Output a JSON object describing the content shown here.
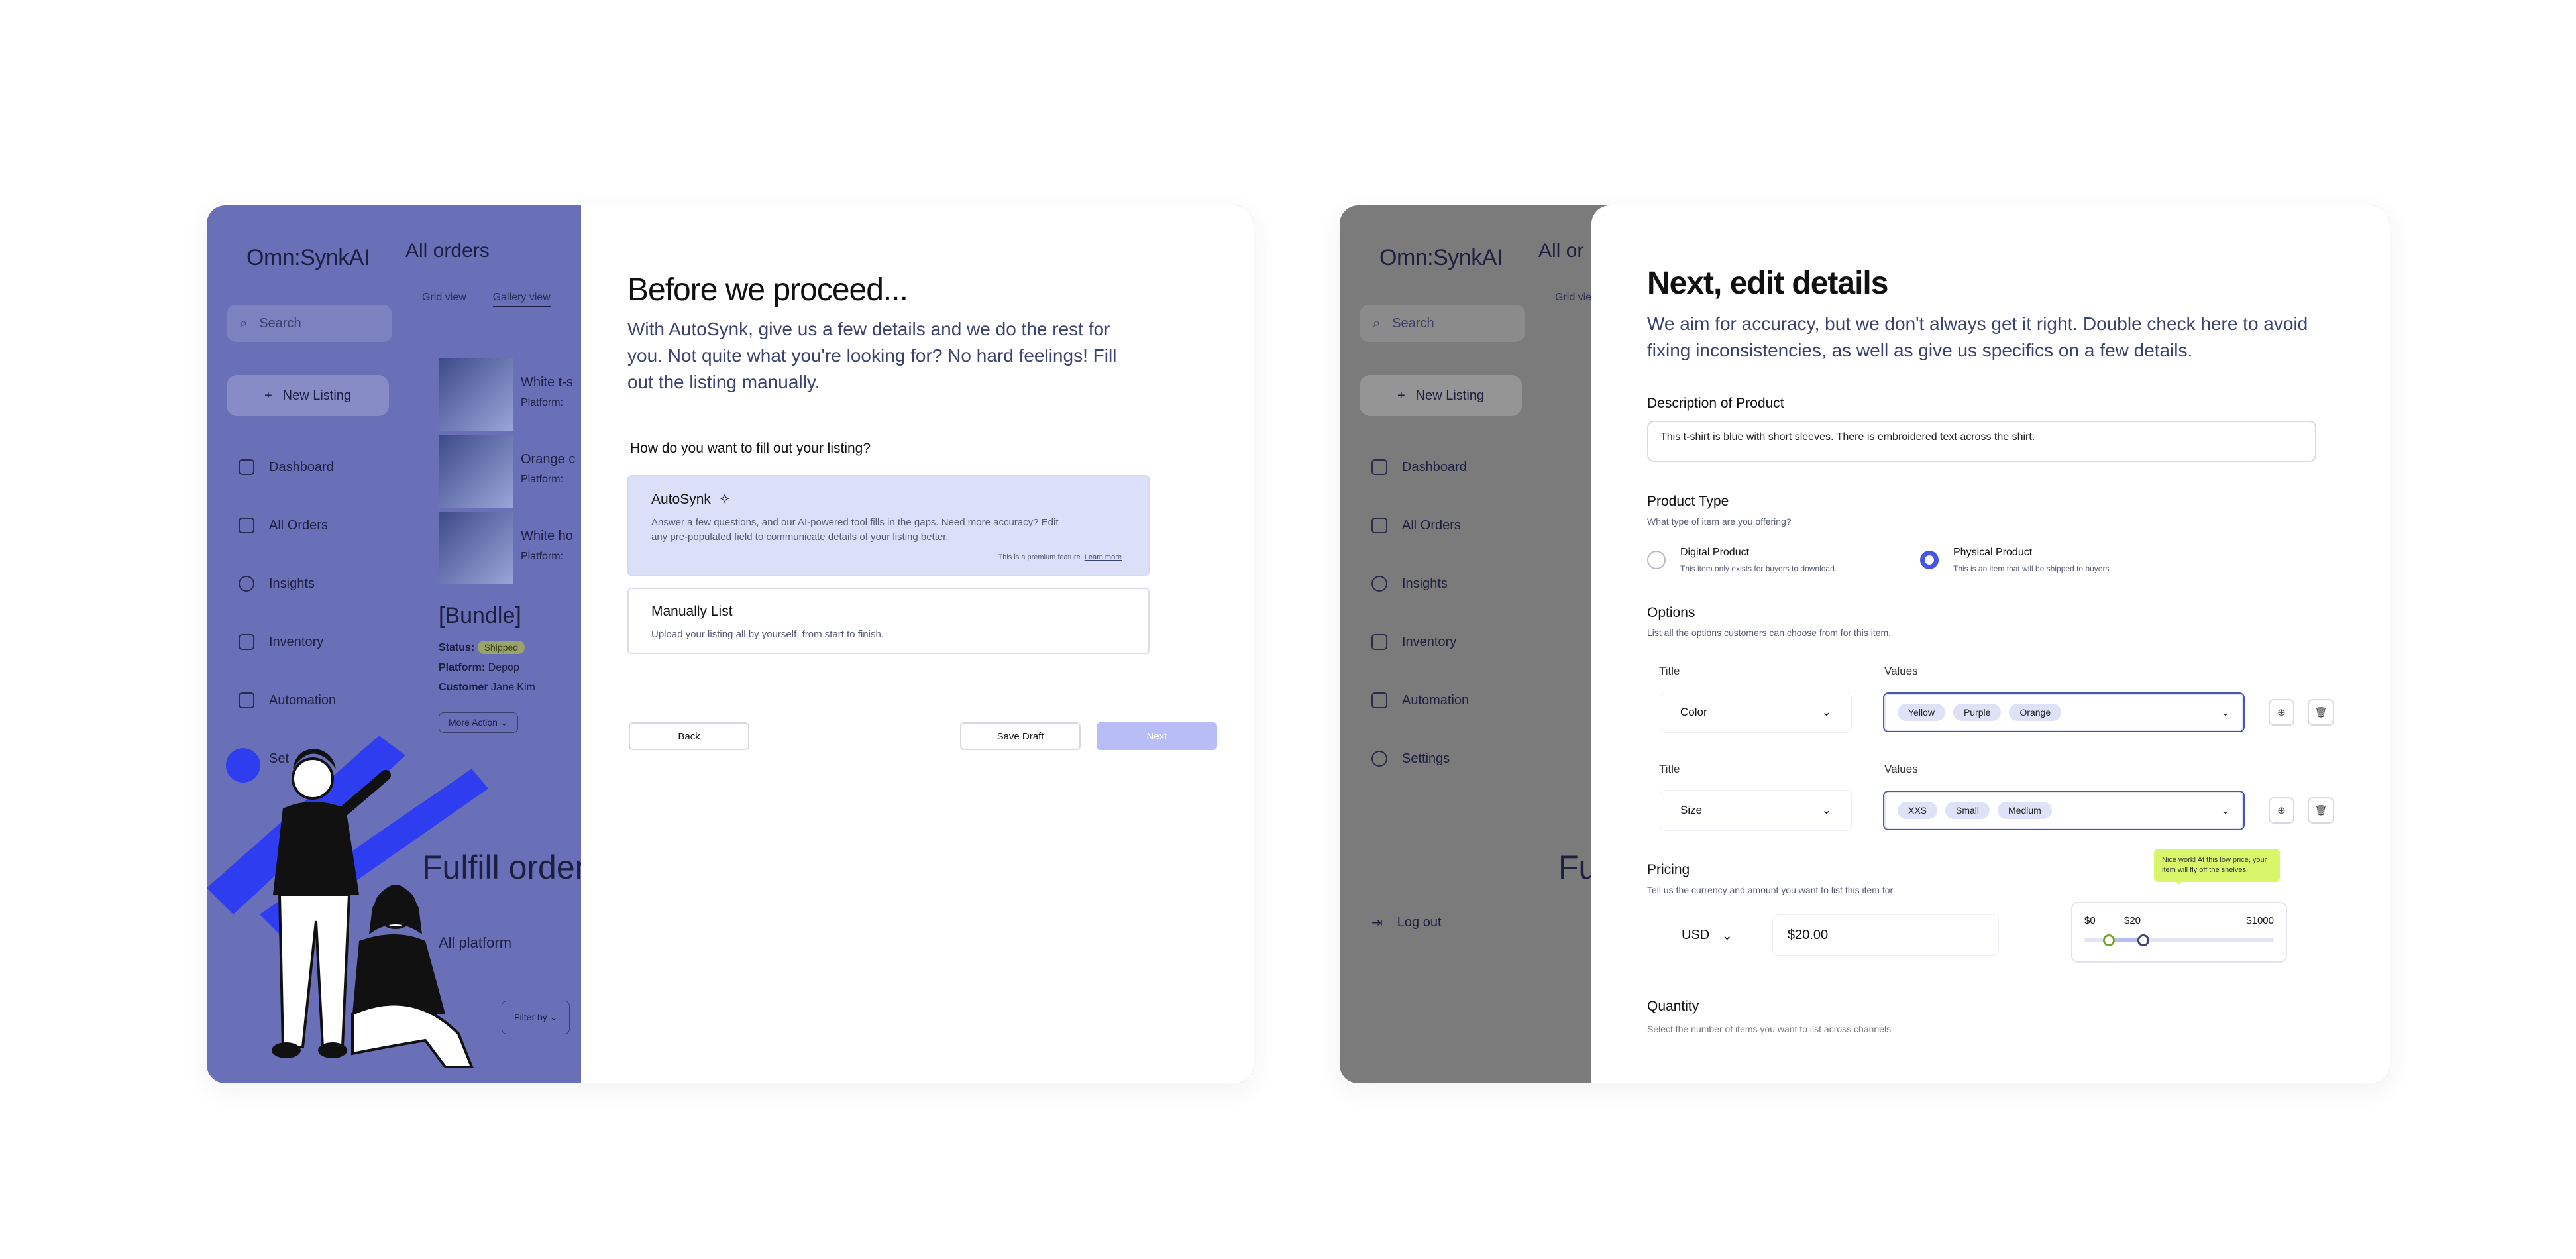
{
  "app": {
    "logo": "Omn:SynkAI",
    "page_title": "All orders",
    "view_tabs": [
      "Grid view",
      "Gallery view"
    ],
    "search_placeholder": "Search",
    "new_listing": "New Listing",
    "nav": [
      "Dashboard",
      "All Orders",
      "Insights",
      "Inventory",
      "Automation",
      "Settings"
    ],
    "nav_icons": [
      "house-icon",
      "calendar-icon",
      "pie-chart-icon",
      "bar-chart-icon",
      "monitor-icon",
      "gear-icon"
    ],
    "nav_left_visible": [
      "Dashboard",
      "All Orders",
      "Insights",
      "Inventory",
      "Automation",
      "Set"
    ],
    "logout": "Log out",
    "gallery_items": [
      {
        "title": "White t-s",
        "platform": "Platform:"
      },
      {
        "title": "Orange c",
        "platform": "Platform:"
      },
      {
        "title": "White ho",
        "platform": "Platform:"
      }
    ],
    "bundle": "[Bundle]",
    "bundle_status_label": "Status:",
    "bundle_status": "Shipped",
    "bundle_platform_label": "Platform:",
    "bundle_platform": "Depop",
    "bundle_customer_label": "Customer",
    "bundle_customer": "Jane Kim",
    "more_action": "More Action",
    "fulfill_title": "Fulfill orders",
    "all_platform": "All platform",
    "filter_by": "Filter by",
    "colors": {
      "overlay_left": "#6a70b8",
      "overlay_right": "#7b7b7b",
      "accent": "#4656e6"
    }
  },
  "modal_left": {
    "title": "Before we proceed...",
    "subtitle": "With AutoSynk, give us a few details and we do the rest for you. Not quite what you're looking for? No hard feelings! Fill out the listing manually.",
    "question": "How do you want to fill out your listing?",
    "options": [
      {
        "title": "AutoSynk",
        "icon": "magic-wand-icon",
        "desc": "Answer a few questions, and our AI-powered tool fills in the gaps. Need more accuracy? Edit any pre-populated field to communicate details of your listing better.",
        "note": "This is a premium feature.",
        "note_link": "Learn more"
      },
      {
        "title": "Manually List",
        "desc": "Upload your listing all by yourself, from start to finish."
      }
    ],
    "back": "Back",
    "save_draft": "Save Draft",
    "next": "Next"
  },
  "modal_right": {
    "title": "Next, edit details",
    "subtitle": "We aim for accuracy, but we don't always get it right. Double check here to avoid fixing inconsistencies, as well as give us specifics on a few details.",
    "description_label": "Description of Product",
    "description_value": "This t-shirt is blue with short sleeves. There is embroidered text across the shirt.",
    "product_type_label": "Product Type",
    "product_type_help": "What type of item are you offering?",
    "product_types": [
      {
        "label": "Digital Product",
        "help": "This item only exists for buyers to download.",
        "checked": false
      },
      {
        "label": "Physical Product",
        "help": "This is an item that will be shipped to buyers.",
        "checked": true
      }
    ],
    "options_label": "Options",
    "options_help": "List all the options customers can choose from for this item.",
    "col_title": "Title",
    "col_values": "Values",
    "option_rows": [
      {
        "title": "Color",
        "values": [
          "Yellow",
          "Purple",
          "Orange"
        ]
      },
      {
        "title": "Size",
        "values": [
          "XXS",
          "Small",
          "Medium"
        ]
      }
    ],
    "pricing_label": "Pricing",
    "pricing_help": "Tell us the currency and amount you want to list this item for.",
    "currency": "USD",
    "price": "$20.00",
    "slider": {
      "min_label": "$0",
      "value_label": "$20",
      "max_label": "$1000",
      "min": 0,
      "max": 1000,
      "value": 20,
      "upper": 200
    },
    "tooltip": "Nice work! At this low price, your item will fly off the shelves.",
    "quantity_label": "Quantity",
    "quantity_help": "Select the number of items you want to list across channels"
  }
}
